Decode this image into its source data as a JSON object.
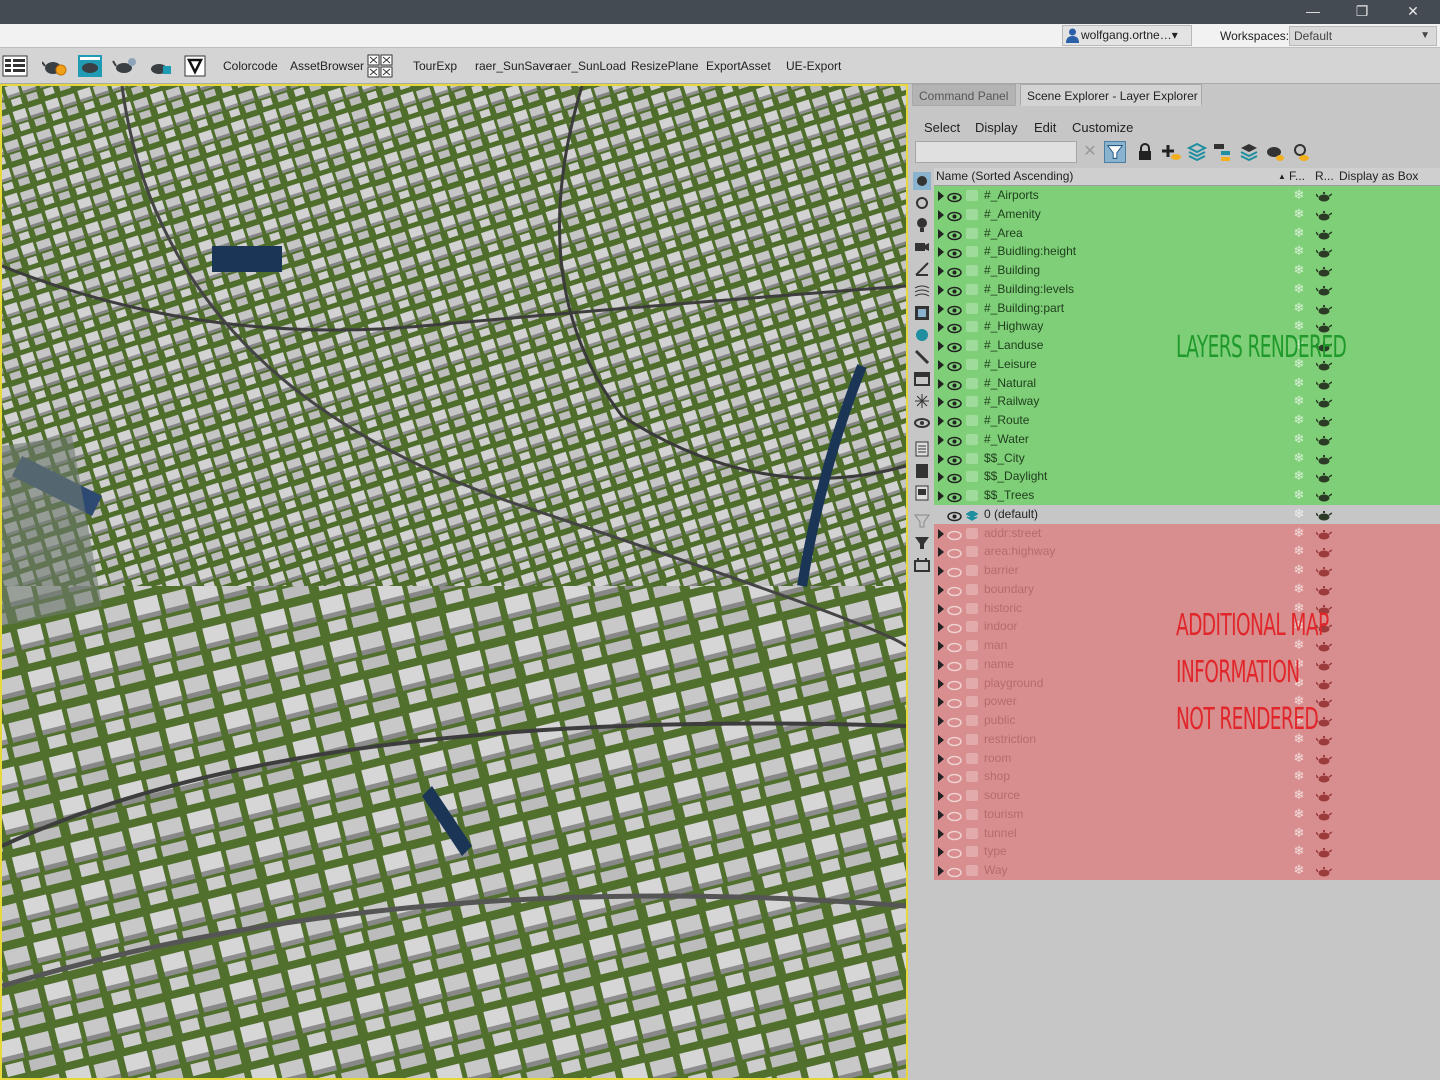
{
  "window": {
    "controls": {
      "minimize": "—",
      "maximize": "❐",
      "close": "✕"
    }
  },
  "account": {
    "user": "wolfgang.ortne…▾",
    "workspaces_label": "Workspaces:",
    "workspace_value": "Default"
  },
  "toolbar": {
    "icons": [
      "menu-grid-icon",
      "sun-teapot-icon",
      "teapot-screen-icon",
      "teapot-cloud-icon",
      "teapot-pencil-icon",
      "funnel-v-icon",
      "grid-4-icon"
    ],
    "colorcode": "Colorcode",
    "assetbrowser": "AssetBrowser",
    "tourexp": "TourExp",
    "sunsave": "raer_SunSave",
    "sunload": "raer_SunLoad",
    "resizeplane": "ResizePlane",
    "exportasset": "ExportAsset",
    "ueexport": "UE-Export"
  },
  "panel": {
    "tabs": [
      "Command Panel",
      "Scene Explorer - Layer Explorer"
    ],
    "menu": [
      "Select",
      "Display",
      "Edit",
      "Customize"
    ],
    "search_placeholder": "",
    "columns": {
      "name": "Name (Sorted Ascending)",
      "sort_indicator": "▲",
      "freeze": "F...",
      "render": "R...",
      "display_box": "Display as Box"
    },
    "layers_rendered": [
      "#_Airports",
      "#_Amenity",
      "#_Area",
      "#_Buidling:height",
      "#_Building",
      "#_Building:levels",
      "#_Building:part",
      "#_Highway",
      "#_Landuse",
      "#_Leisure",
      "#_Natural",
      "#_Railway",
      "#_Route",
      "#_Water",
      "$$_City",
      "$$_Daylight",
      "$$_Trees"
    ],
    "default_layer": "0 (default)",
    "layers_not_rendered": [
      "addr:street",
      "area:highway",
      "barrier",
      "boundary",
      "historic",
      "indoor",
      "man",
      "name",
      "playground",
      "power",
      "public",
      "restriction",
      "room",
      "shop",
      "source",
      "tourism",
      "tunnel",
      "type",
      "Way"
    ],
    "annotation_rendered": "LAYERS RENDERED",
    "annotation_not_rendered": [
      "ADDITIONAL MAP",
      "INFORMATION",
      "NOT RENDERED"
    ],
    "colors": {
      "rendered": "#7fcf78",
      "not_rendered": "#d88e8e",
      "annotation_green": "#1f9a2a",
      "annotation_red": "#e0262a"
    }
  },
  "viewport": {
    "content": "3D city model",
    "colors": {
      "ground": "#4e6b2a",
      "buildings": "#c9c9c9",
      "water": "#1b3556",
      "border": "#e6d83a"
    }
  }
}
